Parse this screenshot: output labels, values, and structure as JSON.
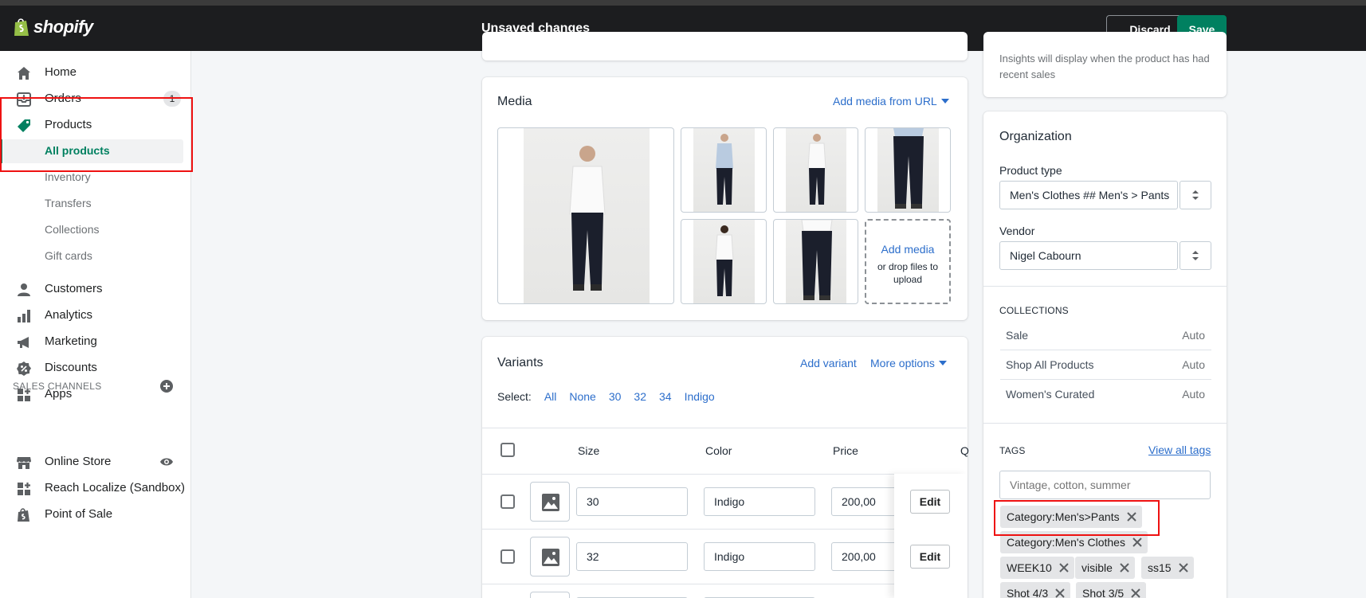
{
  "topbar": {
    "logo": "shopify",
    "status": "Unsaved changes",
    "discard_label": "Discard",
    "save_label": "Save"
  },
  "sidebar": {
    "items": [
      {
        "label": "Home",
        "icon": "home-icon"
      },
      {
        "label": "Orders",
        "icon": "orders-icon",
        "badge": "1"
      },
      {
        "label": "Products",
        "icon": "tag-icon"
      },
      {
        "label": "All products"
      },
      {
        "label": "Inventory"
      },
      {
        "label": "Transfers"
      },
      {
        "label": "Collections"
      },
      {
        "label": "Gift cards"
      },
      {
        "label": "Customers",
        "icon": "person-icon"
      },
      {
        "label": "Analytics",
        "icon": "bar-chart-icon"
      },
      {
        "label": "Marketing",
        "icon": "megaphone-icon"
      },
      {
        "label": "Discounts",
        "icon": "discount-icon"
      },
      {
        "label": "Apps",
        "icon": "apps-icon"
      }
    ],
    "sales_channels_heading": "SALES CHANNELS",
    "channels": [
      {
        "label": "Online Store",
        "icon": "store-icon"
      },
      {
        "label": "Reach Localize (Sandbox)",
        "icon": "apps-icon"
      },
      {
        "label": "Point of Sale",
        "icon": "shopify-bag-icon"
      }
    ]
  },
  "media": {
    "title": "Media",
    "add_from_url": "Add media from URL",
    "add_media": "Add media",
    "drop_text": "or drop files to upload"
  },
  "variants": {
    "title": "Variants",
    "add_variant": "Add variant",
    "more_options": "More options",
    "select_label": "Select:",
    "select_options": [
      "All",
      "None",
      "30",
      "32",
      "34",
      "Indigo"
    ],
    "columns": [
      "Size",
      "Color",
      "Price",
      "Q"
    ],
    "rows": [
      {
        "size": "30",
        "color": "Indigo",
        "price": "200,00",
        "edit": "Edit"
      },
      {
        "size": "32",
        "color": "Indigo",
        "price": "200,00",
        "edit": "Edit"
      }
    ]
  },
  "insights": {
    "text": "Insights will display when the product has had recent sales"
  },
  "organization": {
    "title": "Organization",
    "product_type_label": "Product type",
    "product_type_value": "Men's Clothes ## Men's > Pants",
    "vendor_label": "Vendor",
    "vendor_value": "Nigel Cabourn",
    "collections_heading": "COLLECTIONS",
    "collections": [
      {
        "name": "Sale",
        "type": "Auto"
      },
      {
        "name": "Shop All Products",
        "type": "Auto"
      },
      {
        "name": "Women's Curated",
        "type": "Auto"
      }
    ],
    "tags_heading": "TAGS",
    "view_all_tags": "View all tags",
    "tags_placeholder": "Vintage, cotton, summer",
    "tags": [
      "Category:Men's>Pants",
      "Category:Men's Clothes",
      "WEEK10",
      "visible",
      "ss15",
      "Shot 4/3",
      "Shot 3/5"
    ]
  },
  "colors": {
    "primary": "#008060",
    "link": "#2c6ecb",
    "topbar": "#1c1d1f",
    "highlight": "#ee1111"
  }
}
